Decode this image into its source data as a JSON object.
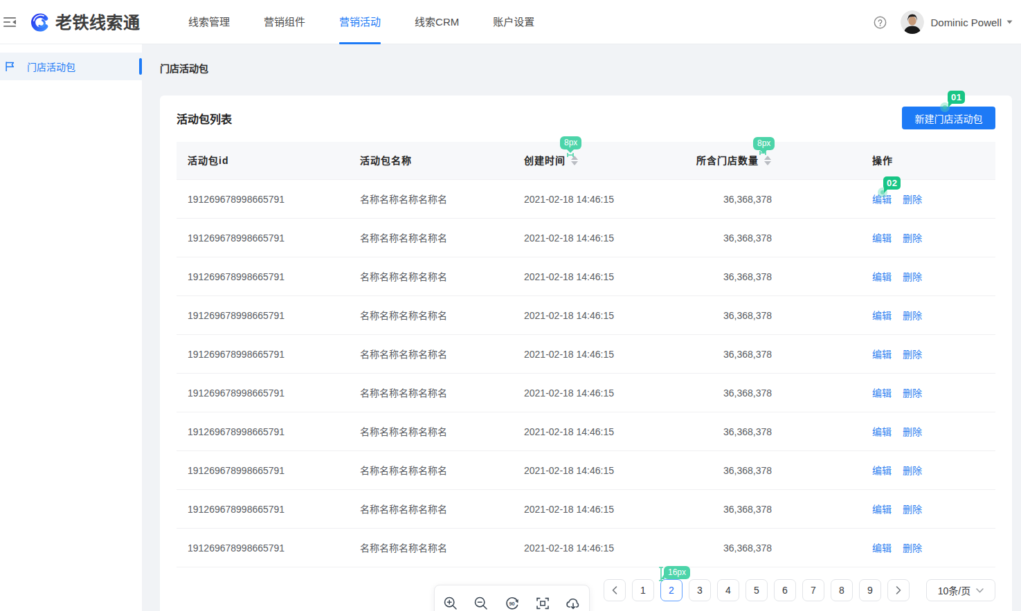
{
  "header": {
    "logo_text": "老铁线索通",
    "nav": [
      {
        "label": "线索管理",
        "active": false
      },
      {
        "label": "营销组件",
        "active": false
      },
      {
        "label": "营销活动",
        "active": true
      },
      {
        "label": "线索CRM",
        "active": false
      },
      {
        "label": "账户设置",
        "active": false
      }
    ],
    "user_name": "Dominic Powell"
  },
  "sidebar": {
    "items": [
      {
        "icon": "flag-icon",
        "label": "门店活动包",
        "active": true
      }
    ]
  },
  "breadcrumb": "门店活动包",
  "card": {
    "title": "活动包列表",
    "create_button": "新建门店活动包"
  },
  "table": {
    "columns": [
      {
        "label": "活动包id",
        "sortable": false
      },
      {
        "label": "活动包名称",
        "sortable": false
      },
      {
        "label": "创建时间",
        "sortable": true
      },
      {
        "label": "所含门店数量",
        "sortable": true
      },
      {
        "label": "操作",
        "sortable": false
      }
    ],
    "actions": {
      "edit": "编辑",
      "delete": "删除"
    },
    "rows": [
      {
        "id": "191269678998665791",
        "name": "名称名称名称名称名",
        "created_at": "2021-02-18 14:46:15",
        "store_count": "36,368,378"
      },
      {
        "id": "191269678998665791",
        "name": "名称名称名称名称名",
        "created_at": "2021-02-18 14:46:15",
        "store_count": "36,368,378"
      },
      {
        "id": "191269678998665791",
        "name": "名称名称名称名称名",
        "created_at": "2021-02-18 14:46:15",
        "store_count": "36,368,378"
      },
      {
        "id": "191269678998665791",
        "name": "名称名称名称名称名",
        "created_at": "2021-02-18 14:46:15",
        "store_count": "36,368,378"
      },
      {
        "id": "191269678998665791",
        "name": "名称名称名称名称名",
        "created_at": "2021-02-18 14:46:15",
        "store_count": "36,368,378"
      },
      {
        "id": "191269678998665791",
        "name": "名称名称名称名称名",
        "created_at": "2021-02-18 14:46:15",
        "store_count": "36,368,378"
      },
      {
        "id": "191269678998665791",
        "name": "名称名称名称名称名",
        "created_at": "2021-02-18 14:46:15",
        "store_count": "36,368,378"
      },
      {
        "id": "191269678998665791",
        "name": "名称名称名称名称名",
        "created_at": "2021-02-18 14:46:15",
        "store_count": "36,368,378"
      },
      {
        "id": "191269678998665791",
        "name": "名称名称名称名称名",
        "created_at": "2021-02-18 14:46:15",
        "store_count": "36,368,378"
      },
      {
        "id": "191269678998665791",
        "name": "名称名称名称名称名",
        "created_at": "2021-02-18 14:46:15",
        "store_count": "36,368,378"
      }
    ]
  },
  "pagination": {
    "pages": [
      "1",
      "2",
      "3",
      "4",
      "5",
      "6",
      "7",
      "8",
      "9"
    ],
    "active_page": "2",
    "page_size": "10条/页"
  },
  "viewer_toolbar": {
    "icons": [
      "zoom-in",
      "zoom-out",
      "rotate-90",
      "fit-screen",
      "cloud-download"
    ]
  },
  "annotations": {
    "markers": [
      {
        "label": "01"
      },
      {
        "label": "02"
      }
    ],
    "measures": [
      {
        "label": "8px"
      },
      {
        "label": "8px"
      },
      {
        "label": "16px"
      }
    ],
    "marker_color": "#18c585",
    "measure_color": "#4cd4a9"
  },
  "colors": {
    "accent": "#1d7af6",
    "link": "#2e7ff0"
  }
}
